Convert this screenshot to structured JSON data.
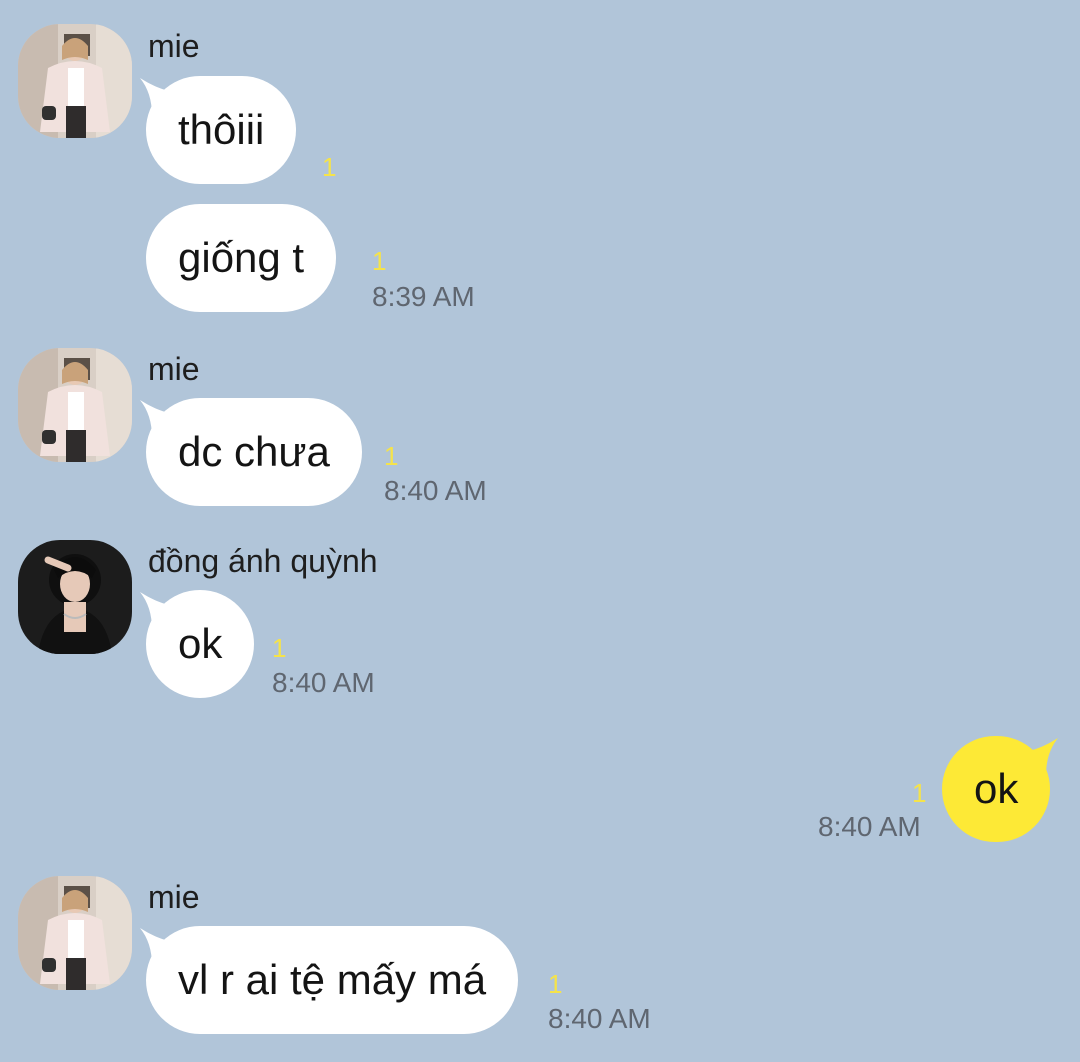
{
  "theme": {
    "background": "#b1c5d9",
    "bubble_incoming": "#ffffff",
    "bubble_outgoing": "#fde936",
    "unread_color": "#f5e34a",
    "time_color": "#5f6670"
  },
  "messages": [
    {
      "sender": "mie",
      "text": "thôiii",
      "unread": "1",
      "time": ""
    },
    {
      "sender": "mie",
      "text": "giống t",
      "unread": "1",
      "time": "8:39 AM"
    },
    {
      "sender": "mie",
      "text": "dc chưa",
      "unread": "1",
      "time": "8:40 AM"
    },
    {
      "sender": "đồng ánh quỳnh",
      "text": "ok",
      "unread": "1",
      "time": "8:40 AM"
    },
    {
      "sender": "",
      "text": "ok",
      "unread": "1",
      "time": "8:40 AM"
    },
    {
      "sender": "mie",
      "text": "vl r ai tệ mấy má",
      "unread": "1",
      "time": "8:40 AM"
    }
  ],
  "avatars": {
    "mie": "avatar-mie-icon",
    "dong_anh_quynh": "avatar-dong-anh-quynh-icon"
  }
}
